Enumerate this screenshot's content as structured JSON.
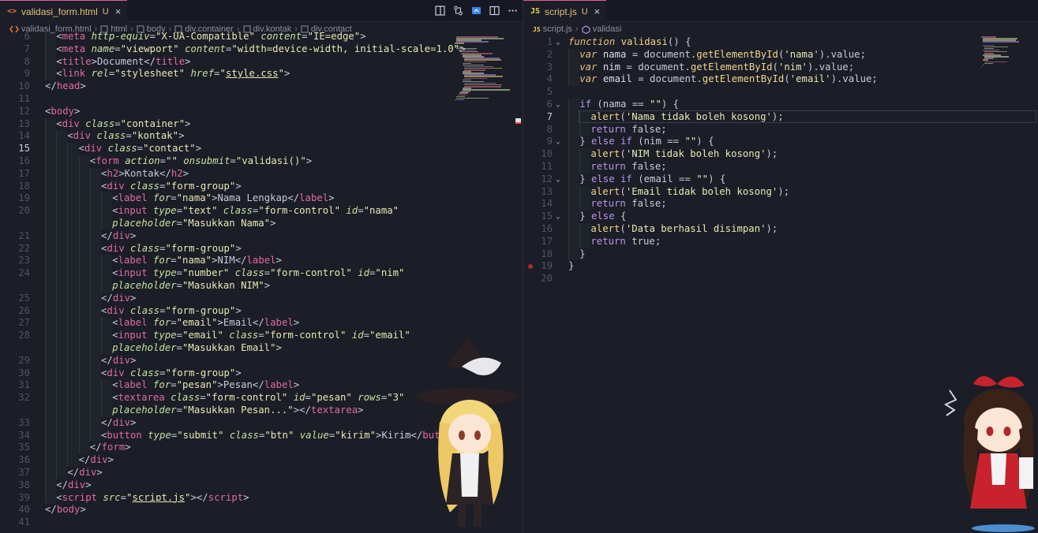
{
  "left": {
    "tab": {
      "type_icon": "<>",
      "filename": "validasi_form.html",
      "status": "U",
      "close": "×"
    },
    "breadcrumb": [
      "validasi_form.html",
      "html",
      "body",
      "div.container",
      "div.kontak",
      "div.contact"
    ],
    "active_line": "15",
    "lines": [
      {
        "n": "6",
        "indent": 1,
        "html": "<span class=\"p\">&lt;</span><span class=\"t\">meta</span> <span class=\"a\">http-equiv</span>=<span class=\"s\">\"X-UA-Compatible\"</span> <span class=\"a\">content</span>=<span class=\"s\">\"IE=edge\"</span><span class=\"p\">&gt;</span>"
      },
      {
        "n": "7",
        "indent": 1,
        "html": "<span class=\"p\">&lt;</span><span class=\"t\">meta</span> <span class=\"a\">name</span>=<span class=\"s\">\"viewport\"</span> <span class=\"a\">content</span>=<span class=\"s\">\"width=device-width, initial-scale=1.0\"</span><span class=\"p\">&gt;</span>"
      },
      {
        "n": "8",
        "indent": 1,
        "html": "<span class=\"p\">&lt;</span><span class=\"t\">title</span><span class=\"p\">&gt;</span>Document<span class=\"p\">&lt;/</span><span class=\"t\">title</span><span class=\"p\">&gt;</span>"
      },
      {
        "n": "9",
        "indent": 1,
        "html": "<span class=\"p\">&lt;</span><span class=\"t\">link</span> <span class=\"a\">rel</span>=<span class=\"s\">\"stylesheet\"</span> <span class=\"a\">href</span>=<span class=\"s\">\"<span class=\"u\">style.css</span>\"</span><span class=\"p\">&gt;</span>"
      },
      {
        "n": "10",
        "indent": 0,
        "html": "<span class=\"p\">&lt;/</span><span class=\"t\">head</span><span class=\"p\">&gt;</span>"
      },
      {
        "n": "11",
        "indent": 0,
        "html": ""
      },
      {
        "n": "12",
        "indent": 0,
        "html": "<span class=\"p\">&lt;</span><span class=\"t\">body</span><span class=\"p\">&gt;</span>"
      },
      {
        "n": "13",
        "indent": 1,
        "html": "<span class=\"p\">&lt;</span><span class=\"t\">div</span> <span class=\"a\">class</span>=<span class=\"s\">\"container\"</span><span class=\"p\">&gt;</span>"
      },
      {
        "n": "14",
        "indent": 2,
        "html": "<span class=\"p\">&lt;</span><span class=\"t\">div</span> <span class=\"a\">class</span>=<span class=\"s\">\"kontak\"</span><span class=\"p\">&gt;</span>"
      },
      {
        "n": "15",
        "indent": 3,
        "html": "<span class=\"p\">&lt;</span><span class=\"t\">div</span> <span class=\"a\">class</span>=<span class=\"s\">\"contact\"</span><span class=\"p\">&gt;</span>"
      },
      {
        "n": "16",
        "indent": 4,
        "html": "<span class=\"p\">&lt;</span><span class=\"t\">form</span> <span class=\"a\">action</span>=<span class=\"s\">\"\"</span> <span class=\"a\">onsubmit</span>=<span class=\"s\">\"validasi()\"</span><span class=\"p\">&gt;</span>"
      },
      {
        "n": "17",
        "indent": 5,
        "html": "<span class=\"p\">&lt;</span><span class=\"t\">h2</span><span class=\"p\">&gt;</span>Kontak<span class=\"p\">&lt;/</span><span class=\"t\">h2</span><span class=\"p\">&gt;</span>"
      },
      {
        "n": "18",
        "indent": 5,
        "html": "<span class=\"p\">&lt;</span><span class=\"t\">div</span> <span class=\"a\">class</span>=<span class=\"s\">\"form-group\"</span><span class=\"p\">&gt;</span>"
      },
      {
        "n": "19",
        "indent": 6,
        "html": "<span class=\"p\">&lt;</span><span class=\"t\">label</span> <span class=\"a\">for</span>=<span class=\"s\">\"nama\"</span><span class=\"p\">&gt;</span>Nama Lengkap<span class=\"p\">&lt;/</span><span class=\"t\">label</span><span class=\"p\">&gt;</span>"
      },
      {
        "n": "20",
        "indent": 6,
        "html": "<span class=\"p\">&lt;</span><span class=\"t\">input</span> <span class=\"a\">type</span>=<span class=\"s\">\"text\"</span> <span class=\"a\">class</span>=<span class=\"s\">\"form-control\"</span> <span class=\"a\">id</span>=<span class=\"s\">\"nama\"</span>"
      },
      {
        "n": "",
        "indent": 6,
        "html": "<span class=\"a\">placeholder</span>=<span class=\"s\">\"Masukkan Nama\"</span><span class=\"p\">&gt;</span>"
      },
      {
        "n": "21",
        "indent": 5,
        "html": "<span class=\"p\">&lt;/</span><span class=\"t\">div</span><span class=\"p\">&gt;</span>"
      },
      {
        "n": "22",
        "indent": 5,
        "html": "<span class=\"p\">&lt;</span><span class=\"t\">div</span> <span class=\"a\">class</span>=<span class=\"s\">\"form-group\"</span><span class=\"p\">&gt;</span>"
      },
      {
        "n": "23",
        "indent": 6,
        "html": "<span class=\"p\">&lt;</span><span class=\"t\">label</span> <span class=\"a\">for</span>=<span class=\"s\">\"nama\"</span><span class=\"p\">&gt;</span>NIM<span class=\"p\">&lt;/</span><span class=\"t\">label</span><span class=\"p\">&gt;</span>"
      },
      {
        "n": "24",
        "indent": 6,
        "html": "<span class=\"p\">&lt;</span><span class=\"t\">input</span> <span class=\"a\">type</span>=<span class=\"s\">\"number\"</span> <span class=\"a\">class</span>=<span class=\"s\">\"form-control\"</span> <span class=\"a\">id</span>=<span class=\"s\">\"nim\"</span>"
      },
      {
        "n": "",
        "indent": 6,
        "html": "<span class=\"a\">placeholder</span>=<span class=\"s\">\"Masukkan NIM\"</span><span class=\"p\">&gt;</span>"
      },
      {
        "n": "25",
        "indent": 5,
        "html": "<span class=\"p\">&lt;/</span><span class=\"t\">div</span><span class=\"p\">&gt;</span>"
      },
      {
        "n": "26",
        "indent": 5,
        "html": "<span class=\"p\">&lt;</span><span class=\"t\">div</span> <span class=\"a\">class</span>=<span class=\"s\">\"form-group\"</span><span class=\"p\">&gt;</span>"
      },
      {
        "n": "27",
        "indent": 6,
        "html": "<span class=\"p\">&lt;</span><span class=\"t\">label</span> <span class=\"a\">for</span>=<span class=\"s\">\"email\"</span><span class=\"p\">&gt;</span>Email<span class=\"p\">&lt;/</span><span class=\"t\">label</span><span class=\"p\">&gt;</span>"
      },
      {
        "n": "28",
        "indent": 6,
        "html": "<span class=\"p\">&lt;</span><span class=\"t\">input</span> <span class=\"a\">type</span>=<span class=\"s\">\"email\"</span> <span class=\"a\">class</span>=<span class=\"s\">\"form-control\"</span> <span class=\"a\">id</span>=<span class=\"s\">\"email\"</span>"
      },
      {
        "n": "",
        "indent": 6,
        "html": "<span class=\"a\">placeholder</span>=<span class=\"s\">\"Masukkan Email\"</span><span class=\"p\">&gt;</span>"
      },
      {
        "n": "29",
        "indent": 5,
        "html": "<span class=\"p\">&lt;/</span><span class=\"t\">div</span><span class=\"p\">&gt;</span>"
      },
      {
        "n": "30",
        "indent": 5,
        "html": "<span class=\"p\">&lt;</span><span class=\"t\">div</span> <span class=\"a\">class</span>=<span class=\"s\">\"form-group\"</span><span class=\"p\">&gt;</span>"
      },
      {
        "n": "31",
        "indent": 6,
        "html": "<span class=\"p\">&lt;</span><span class=\"t\">label</span> <span class=\"a\">for</span>=<span class=\"s\">\"pesan\"</span><span class=\"p\">&gt;</span>Pesan<span class=\"p\">&lt;/</span><span class=\"t\">label</span><span class=\"p\">&gt;</span>"
      },
      {
        "n": "32",
        "indent": 6,
        "html": "<span class=\"p\">&lt;</span><span class=\"t\">textarea</span> <span class=\"a\">class</span>=<span class=\"s\">\"form-control\"</span> <span class=\"a\">id</span>=<span class=\"s\">\"pesan\"</span> <span class=\"a\">rows</span>=<span class=\"s\">\"3\"</span>"
      },
      {
        "n": "",
        "indent": 6,
        "html": "<span class=\"a\">placeholder</span>=<span class=\"s\">\"Masukkan Pesan...\"</span><span class=\"p\">&gt;&lt;/</span><span class=\"t\">textarea</span><span class=\"p\">&gt;</span>"
      },
      {
        "n": "33",
        "indent": 5,
        "html": "<span class=\"p\">&lt;/</span><span class=\"t\">div</span><span class=\"p\">&gt;</span>"
      },
      {
        "n": "34",
        "indent": 5,
        "html": "<span class=\"p\">&lt;</span><span class=\"t\">button</span> <span class=\"a\">type</span>=<span class=\"s\">\"submit\"</span> <span class=\"a\">class</span>=<span class=\"s\">\"btn\"</span> <span class=\"a\">value</span>=<span class=\"s\">\"kirim\"</span><span class=\"p\">&gt;</span>Kirim<span class=\"p\">&lt;/</span><span class=\"t\">button</span><span class=\"p\">&gt;</span>"
      },
      {
        "n": "35",
        "indent": 4,
        "html": "<span class=\"p\">&lt;/</span><span class=\"t\">form</span><span class=\"p\">&gt;</span>"
      },
      {
        "n": "36",
        "indent": 3,
        "html": "<span class=\"p\">&lt;/</span><span class=\"t\">div</span><span class=\"p\">&gt;</span>"
      },
      {
        "n": "37",
        "indent": 2,
        "html": "<span class=\"p\">&lt;/</span><span class=\"t\">div</span><span class=\"p\">&gt;</span>"
      },
      {
        "n": "38",
        "indent": 1,
        "html": "<span class=\"p\">&lt;/</span><span class=\"t\">div</span><span class=\"p\">&gt;</span>"
      },
      {
        "n": "39",
        "indent": 1,
        "html": "<span class=\"p\">&lt;</span><span class=\"t\">script</span> <span class=\"a\">src</span>=<span class=\"s\">\"<span class=\"u\">script.js</span>\"</span><span class=\"p\">&gt;&lt;/</span><span class=\"t\">script</span><span class=\"p\">&gt;</span>"
      },
      {
        "n": "40",
        "indent": 0,
        "html": "<span class=\"p\">&lt;/</span><span class=\"t\">body</span><span class=\"p\">&gt;</span>"
      },
      {
        "n": "41",
        "indent": 0,
        "html": ""
      }
    ]
  },
  "right": {
    "tab": {
      "type_icon": "JS",
      "filename": "script.js",
      "status": "U",
      "close": "×"
    },
    "breadcrumb": [
      "script.js",
      "validasi"
    ],
    "active_line": "7",
    "lines": [
      {
        "n": "1",
        "indent": 0,
        "fold": true,
        "html": "<span class=\"k\">function</span> <span class=\"f\">validasi</span>() {"
      },
      {
        "n": "2",
        "indent": 1,
        "html": "<span class=\"k\">var</span> <span class=\"v\">nama</span> = document.<span class=\"f\">getElementById</span>(<span class=\"s\">'nama'</span>).value;"
      },
      {
        "n": "3",
        "indent": 1,
        "html": "<span class=\"k\">var</span> <span class=\"v\">nim</span> = document.<span class=\"f\">getElementById</span>(<span class=\"s\">'nim'</span>).value;"
      },
      {
        "n": "4",
        "indent": 1,
        "html": "<span class=\"k\">var</span> <span class=\"v\">email</span> = document.<span class=\"f\">getElementById</span>(<span class=\"s\">'email'</span>).value;"
      },
      {
        "n": "5",
        "indent": 0,
        "html": ""
      },
      {
        "n": "6",
        "indent": 1,
        "fold": true,
        "html": "<span class=\"kw\">if</span> (nama == <span class=\"s\">\"\"</span>) {"
      },
      {
        "n": "7",
        "indent": 2,
        "html": "<span class=\"f\">alert</span>(<span class=\"s\">'Nama tidak boleh kosong'</span>);"
      },
      {
        "n": "8",
        "indent": 2,
        "html": "<span class=\"kw\">return</span> false;"
      },
      {
        "n": "9",
        "indent": 1,
        "fold": true,
        "html": "} <span class=\"kw\">else if</span> (nim == <span class=\"s\">\"\"</span>) {"
      },
      {
        "n": "10",
        "indent": 2,
        "html": "<span class=\"f\">alert</span>(<span class=\"s\">'NIM tidak boleh kosong'</span>);"
      },
      {
        "n": "11",
        "indent": 2,
        "html": "<span class=\"kw\">return</span> false;"
      },
      {
        "n": "12",
        "indent": 1,
        "fold": true,
        "html": "} <span class=\"kw\">else if</span> (email == <span class=\"s\">\"\"</span>) {"
      },
      {
        "n": "13",
        "indent": 2,
        "html": "<span class=\"f\">alert</span>(<span class=\"s\">'Email tidak boleh kosong'</span>);"
      },
      {
        "n": "14",
        "indent": 2,
        "html": "<span class=\"kw\">return</span> false;"
      },
      {
        "n": "15",
        "indent": 1,
        "fold": true,
        "html": "} <span class=\"kw\">else</span> {"
      },
      {
        "n": "16",
        "indent": 2,
        "html": "<span class=\"f\">alert</span>(<span class=\"s\">'Data berhasil disimpan'</span>);"
      },
      {
        "n": "17",
        "indent": 2,
        "html": "<span class=\"kw\">return</span> true;"
      },
      {
        "n": "18",
        "indent": 1,
        "html": "}"
      },
      {
        "n": "19",
        "indent": 0,
        "breakpoint": true,
        "html": "}"
      },
      {
        "n": "20",
        "indent": 0,
        "html": ""
      }
    ]
  },
  "colors": {
    "background": "#1b1d27",
    "tab_accent": "#e35d8f",
    "modified": "#e5c07b",
    "tag": "#e06c9f",
    "keyword": "#b996e8"
  }
}
